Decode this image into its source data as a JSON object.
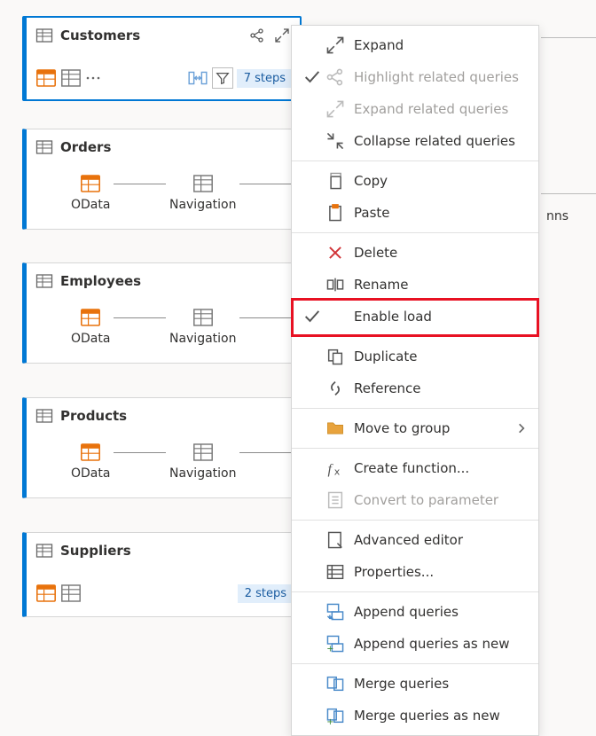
{
  "cards": {
    "customers": {
      "title": "Customers",
      "steps": "7 steps"
    },
    "orders": {
      "title": "Orders",
      "step1": "OData",
      "step2": "Navigation"
    },
    "employees": {
      "title": "Employees",
      "step1": "OData",
      "step2": "Navigation"
    },
    "products": {
      "title": "Products",
      "step1": "OData",
      "step2": "Navigation"
    },
    "suppliers": {
      "title": "Suppliers",
      "steps": "2 steps"
    }
  },
  "menu": {
    "expand": "Expand",
    "highlight_related": "Highlight related queries",
    "expand_related": "Expand related queries",
    "collapse_related": "Collapse related queries",
    "copy": "Copy",
    "paste": "Paste",
    "delete": "Delete",
    "rename": "Rename",
    "enable_load": "Enable load",
    "duplicate": "Duplicate",
    "reference": "Reference",
    "move_to_group": "Move to group",
    "create_function": "Create function...",
    "convert_to_parameter": "Convert to parameter",
    "advanced_editor": "Advanced editor",
    "properties": "Properties...",
    "append_queries": "Append queries",
    "append_queries_as_new": "Append queries as new",
    "merge_queries": "Merge queries",
    "merge_queries_as_new": "Merge queries as new"
  },
  "bg": {
    "label": "nns"
  }
}
